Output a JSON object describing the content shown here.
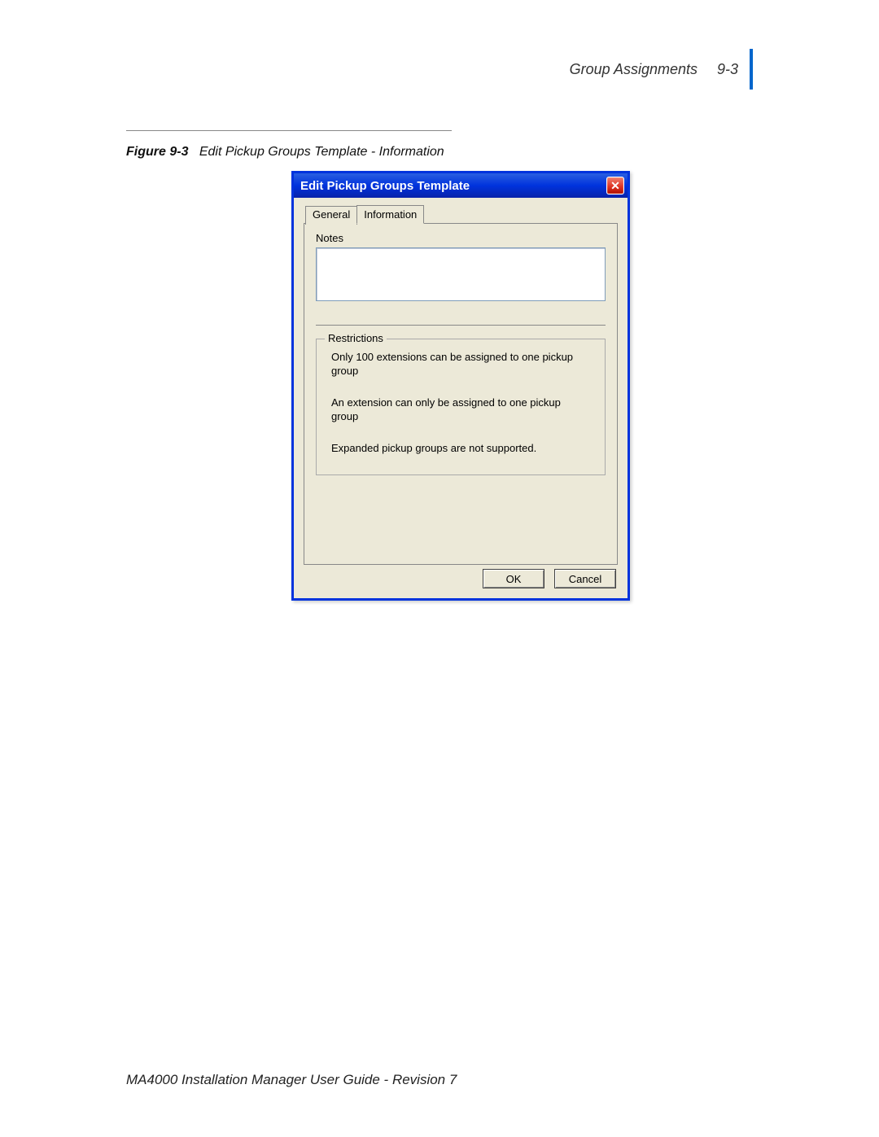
{
  "header": {
    "section_title": "Group Assignments",
    "page_number": "9-3"
  },
  "figure": {
    "label_prefix": "Figure 9-3",
    "caption": "Edit Pickup Groups Template - Information"
  },
  "dialog": {
    "title": "Edit Pickup Groups Template",
    "close_label": "✕",
    "tabs": {
      "general": "General",
      "information": "Information"
    },
    "notes_label": "Notes",
    "notes_value": "",
    "restrictions": {
      "legend": "Restrictions",
      "items": [
        "Only 100 extensions can be assigned to one pickup group",
        "An extension can only be assigned to one pickup group",
        "Expanded pickup groups are not supported."
      ]
    },
    "buttons": {
      "ok": "OK",
      "cancel": "Cancel"
    }
  },
  "footer": {
    "text": "MA4000 Installation Manager User Guide - Revision 7"
  }
}
